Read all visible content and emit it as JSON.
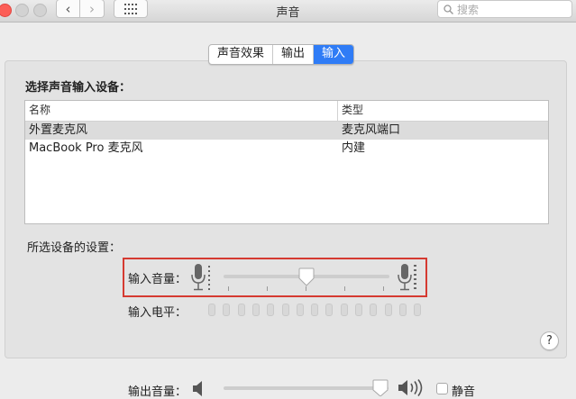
{
  "window": {
    "title": "声音"
  },
  "toolbar": {
    "back_glyph": "‹",
    "forward_glyph": "›",
    "grid_icon": "grid-icon"
  },
  "search": {
    "placeholder": "搜索"
  },
  "tabs": [
    {
      "label": "声音效果",
      "active": false
    },
    {
      "label": "输出",
      "active": false
    },
    {
      "label": "输入",
      "active": true
    }
  ],
  "device_section": {
    "title": "选择声音输入设备："
  },
  "device_table": {
    "columns": [
      "名称",
      "类型"
    ],
    "rows": [
      {
        "name": "外置麦克风",
        "type": "麦克风端口",
        "selected": true
      },
      {
        "name": "MacBook Pro 麦克风",
        "type": "内建",
        "selected": false
      }
    ]
  },
  "settings_section": {
    "title": "所选设备的设置："
  },
  "input_volume": {
    "label": "输入音量：",
    "value": 0.5
  },
  "input_level": {
    "label": "输入电平：",
    "segments": 15,
    "active": 0
  },
  "help": {
    "label": "?"
  },
  "output_volume": {
    "label": "输出音量：",
    "value": 0.95
  },
  "mute": {
    "label": "静音",
    "checked": false
  },
  "colors": {
    "accent": "#2f7cf6",
    "highlight_box": "#d53a31"
  }
}
